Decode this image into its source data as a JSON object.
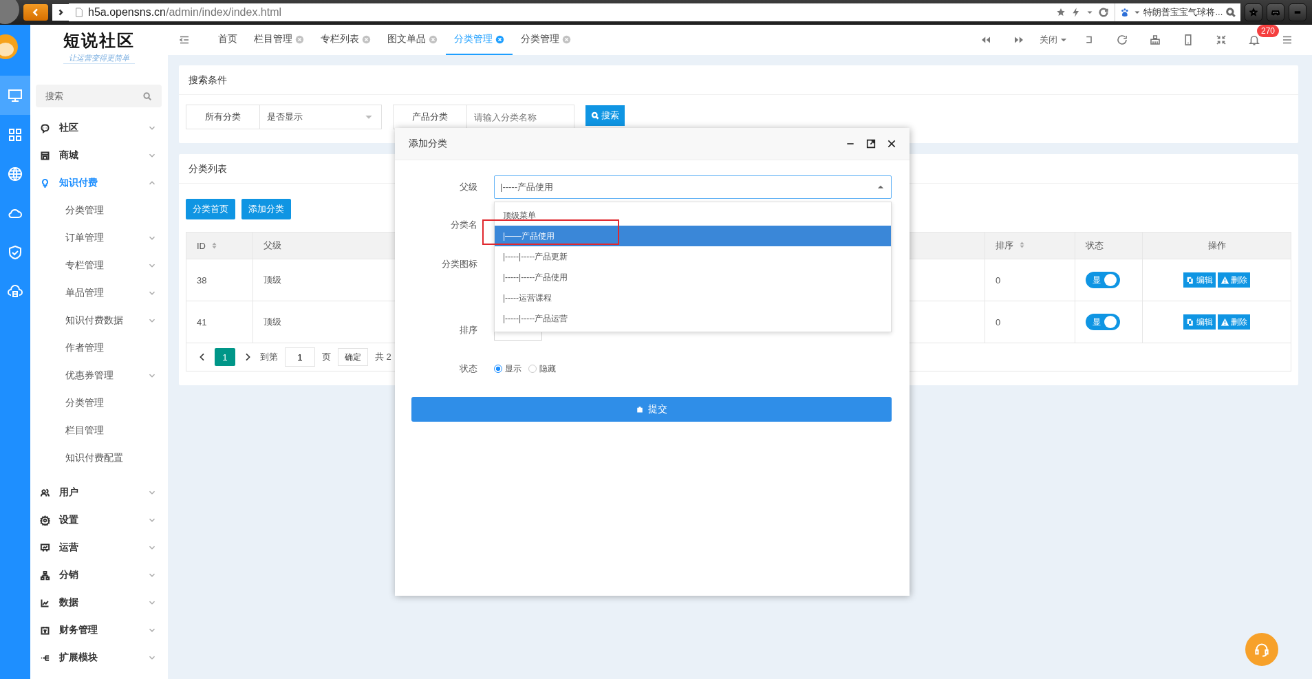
{
  "browser": {
    "url_host": "h5a.opensns.cn",
    "url_path": "/admin/index/index.html",
    "search_text": "特朗普宝宝气球将..."
  },
  "rail": [
    {
      "kind": "monitor",
      "selected": true
    },
    {
      "kind": "grid",
      "selected": false
    },
    {
      "kind": "globe",
      "selected": false
    },
    {
      "kind": "cloud",
      "selected": false
    },
    {
      "kind": "shield",
      "selected": false
    },
    {
      "kind": "cloudbox",
      "selected": false
    }
  ],
  "brand": {
    "title": "短说社区",
    "slogan": "让运营变得更简单"
  },
  "sidebar": {
    "search": {
      "placeholder": "搜索"
    },
    "items": [
      {
        "label": "社区",
        "expanded": false,
        "selected": false
      },
      {
        "label": "商城",
        "expanded": false,
        "selected": false
      },
      {
        "label": "知识付费",
        "expanded": true,
        "selected": true,
        "children": [
          {
            "label": "分类管理",
            "kind": "link"
          },
          {
            "label": "订单管理",
            "kind": "group"
          },
          {
            "label": "专栏管理",
            "kind": "group"
          },
          {
            "label": "单品管理",
            "kind": "group"
          },
          {
            "label": "知识付费数据",
            "kind": "group"
          },
          {
            "label": "作者管理",
            "kind": "link"
          },
          {
            "label": "优惠券管理",
            "kind": "group"
          },
          {
            "label": "分类管理",
            "kind": "link"
          },
          {
            "label": "栏目管理",
            "kind": "link"
          },
          {
            "label": "知识付费配置",
            "kind": "link"
          }
        ]
      },
      {
        "label": "用户",
        "expanded": false,
        "selected": false
      },
      {
        "label": "设置",
        "expanded": false,
        "selected": false
      },
      {
        "label": "运营",
        "expanded": false,
        "selected": false
      },
      {
        "label": "分销",
        "expanded": false,
        "selected": false
      },
      {
        "label": "数据",
        "expanded": false,
        "selected": false
      },
      {
        "label": "财务管理",
        "expanded": false,
        "selected": false
      },
      {
        "label": "扩展模块",
        "expanded": false,
        "selected": false
      }
    ]
  },
  "tabs": [
    {
      "label": "首页",
      "closable": false,
      "selected": false
    },
    {
      "label": "栏目管理",
      "closable": true,
      "selected": false
    },
    {
      "label": "专栏列表",
      "closable": true,
      "selected": false
    },
    {
      "label": "图文单品",
      "closable": true,
      "selected": false
    },
    {
      "label": "分类管理",
      "closable": true,
      "selected": true
    },
    {
      "label": "分类管理",
      "closable": true,
      "selected": false
    }
  ],
  "toolbar": {
    "close_menu": "关闭",
    "badge": "270"
  },
  "search_panel": {
    "title": "搜索条件",
    "filters": [
      {
        "label": "所有分类",
        "kind": "select",
        "value": "是否显示"
      },
      {
        "label": "产品分类",
        "kind": "input",
        "placeholder": "请输入分类名称"
      }
    ],
    "button": "搜索"
  },
  "list_panel": {
    "title": "分类列表",
    "buttons": [
      "分类首页",
      "添加分类"
    ],
    "columns": [
      {
        "label": "ID",
        "sortable": true
      },
      {
        "label": "父级",
        "sortable": false
      },
      {
        "label": "排序",
        "sortable": true
      },
      {
        "label": "状态",
        "sortable": false
      },
      {
        "label": "操作",
        "sortable": false
      }
    ],
    "rows": [
      {
        "id": "38",
        "parent": "顶级",
        "order": "0",
        "status": {
          "label": "显",
          "on": true
        },
        "actions": [
          "编辑",
          "删除"
        ]
      },
      {
        "id": "41",
        "parent": "顶级",
        "order": "0",
        "status": {
          "label": "显",
          "on": true
        },
        "actions": [
          "编辑",
          "删除"
        ]
      }
    ],
    "pagination": {
      "current": "1",
      "goto_label": "到第",
      "page_value": "1",
      "page_unit": "页",
      "confirm": "确定",
      "total": "共 2"
    }
  },
  "dialog": {
    "title": "添加分类",
    "parent": {
      "label": "父级",
      "value": "|-----产品使用",
      "open": true,
      "options": [
        {
          "label": "顶级菜单",
          "selected": false
        },
        {
          "label": "|——产品使用",
          "selected": true
        },
        {
          "label": "|-----|-----产品更新",
          "selected": false
        },
        {
          "label": "|-----|-----产品使用",
          "selected": false
        },
        {
          "label": "|-----运营课程",
          "selected": false
        },
        {
          "label": "|-----|-----产品运营",
          "selected": false
        }
      ]
    },
    "name_label": "分类名",
    "icon_label": "分类图标",
    "order_label": "排序",
    "status": {
      "label": "状态",
      "options": [
        {
          "label": "显示",
          "selected": true
        },
        {
          "label": "隐藏",
          "selected": false
        }
      ]
    },
    "submit": "提交"
  }
}
